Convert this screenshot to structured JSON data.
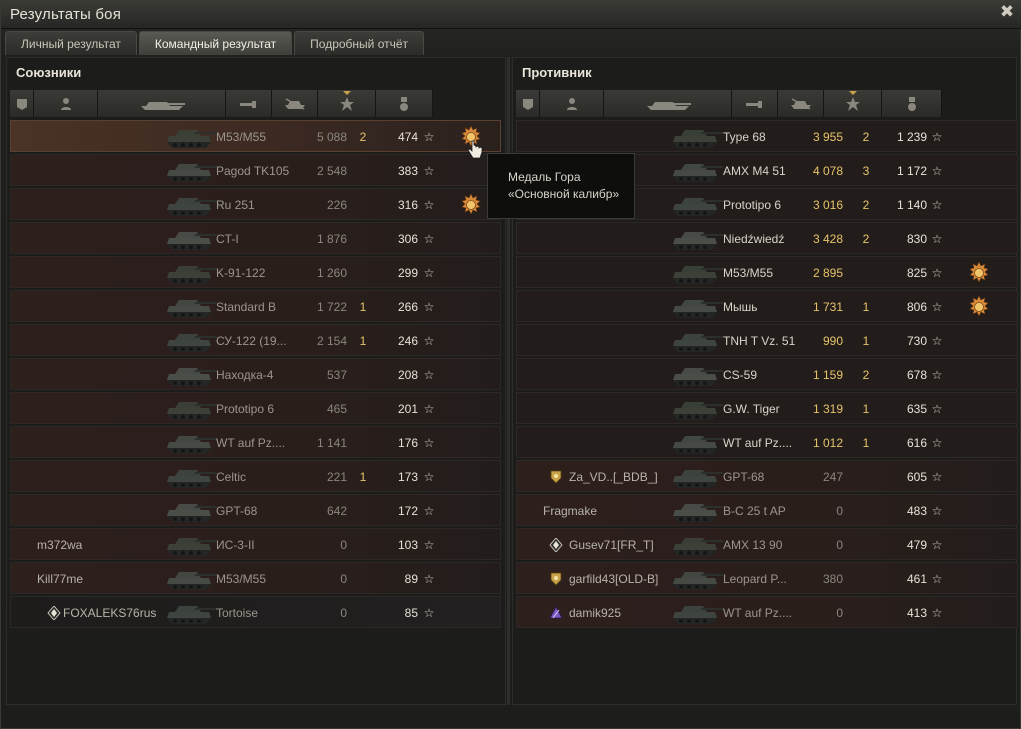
{
  "window": {
    "title": "Результаты боя",
    "close_glyph": "✖"
  },
  "tabs": [
    {
      "label": "Личный результат",
      "active": false
    },
    {
      "label": "Командный результат",
      "active": true
    },
    {
      "label": "Подробный отчёт",
      "active": false
    }
  ],
  "allies": {
    "title": "Союзники",
    "columns": [
      "platoon-icon",
      "player-icon",
      "tank-icon",
      "damage-icon",
      "frags-icon",
      "xp-star-icon",
      "medal-icon"
    ],
    "rows": [
      {
        "player": "",
        "tank": "M53/M55",
        "damage": "5 088",
        "kills": "2",
        "xp": "474",
        "medal": true,
        "style": "self"
      },
      {
        "player": "",
        "tank": "Pagod TK105",
        "damage": "2 548",
        "kills": "",
        "xp": "383",
        "medal": false,
        "style": "tint"
      },
      {
        "player": "",
        "tank": "Ru 251",
        "damage": "226",
        "kills": "",
        "xp": "316",
        "medal": true,
        "style": "tint"
      },
      {
        "player": "",
        "tank": "CT-I",
        "damage": "1 876",
        "kills": "",
        "xp": "306",
        "medal": false,
        "style": "tint"
      },
      {
        "player": "",
        "tank": "K-91-122",
        "damage": "1 260",
        "kills": "",
        "xp": "299",
        "medal": false,
        "style": "tint"
      },
      {
        "player": "",
        "tank": "Standard B",
        "damage": "1 722",
        "kills": "1",
        "xp": "266",
        "medal": false,
        "style": "tint"
      },
      {
        "player": "",
        "tank": "СУ-122 (19...",
        "damage": "2 154",
        "kills": "1",
        "xp": "246",
        "medal": false,
        "style": "tint"
      },
      {
        "player": "",
        "tank": "Находка-4",
        "damage": "537",
        "kills": "",
        "xp": "208",
        "medal": false,
        "style": "tint"
      },
      {
        "player": "",
        "tank": "Prototipo 6",
        "damage": "465",
        "kills": "",
        "xp": "201",
        "medal": false,
        "style": "tint"
      },
      {
        "player": "",
        "tank": "WT auf Pz....",
        "damage": "1 141",
        "kills": "",
        "xp": "176",
        "medal": false,
        "style": "tint"
      },
      {
        "player": "",
        "tank": "Celtic",
        "damage": "221",
        "kills": "1",
        "xp": "173",
        "medal": false,
        "style": "tint"
      },
      {
        "player": "",
        "tank": "GPT-68",
        "damage": "642",
        "kills": "",
        "xp": "172",
        "medal": false,
        "style": "tint"
      },
      {
        "player": "m372wa",
        "tank": "ИС-3-II",
        "damage": "0",
        "kills": "",
        "xp": "103",
        "medal": false,
        "style": "tint"
      },
      {
        "player": "Kill77me",
        "tank": "M53/M55",
        "damage": "0",
        "kills": "",
        "xp": "89",
        "medal": false,
        "style": "tint"
      },
      {
        "player": "FOXALEKS76rus",
        "tank": "Tortoise",
        "damage": "0",
        "kills": "",
        "xp": "85",
        "medal": false,
        "style": "dark",
        "badge": "white"
      }
    ]
  },
  "enemies": {
    "title": "Противник",
    "columns": [
      "platoon-icon",
      "player-icon",
      "tank-icon",
      "damage-icon",
      "frags-icon",
      "xp-star-icon",
      "medal-icon"
    ],
    "rows": [
      {
        "player": "",
        "tank": "Type 68",
        "damage": "3 955",
        "kills": "2",
        "xp": "1 239",
        "medal": false
      },
      {
        "player": "",
        "tank": "AMX M4 51",
        "damage": "4 078",
        "kills": "3",
        "xp": "1 172",
        "medal": false
      },
      {
        "player": "",
        "tank": "Prototipo 6",
        "damage": "3 016",
        "kills": "2",
        "xp": "1 140",
        "medal": false
      },
      {
        "player": "",
        "tank": "Niedźwiedź",
        "damage": "3 428",
        "kills": "2",
        "xp": "830",
        "medal": false
      },
      {
        "player": "",
        "tank": "M53/M55",
        "damage": "2 895",
        "kills": "",
        "xp": "825",
        "medal": true
      },
      {
        "player": "",
        "tank": "Мышь",
        "damage": "1 731",
        "kills": "1",
        "xp": "806",
        "medal": true
      },
      {
        "player": "",
        "tank": "TNH T Vz. 51",
        "damage": "990",
        "kills": "1",
        "xp": "730",
        "medal": false
      },
      {
        "player": "",
        "tank": "CS-59",
        "damage": "1 159",
        "kills": "2",
        "xp": "678",
        "medal": false
      },
      {
        "player": "",
        "tank": "G.W. Tiger",
        "damage": "1 319",
        "kills": "1",
        "xp": "635",
        "medal": false
      },
      {
        "player": "",
        "tank": "WT auf Pz....",
        "damage": "1 012",
        "kills": "1",
        "xp": "616",
        "medal": false
      },
      {
        "player": "Za_VD..[_BDB_]",
        "tank": "GPT-68",
        "damage": "247",
        "kills": "",
        "xp": "605",
        "medal": false,
        "dim": true,
        "badge": "gold"
      },
      {
        "player": "Fragmake",
        "tank": "B-C 25 t AP",
        "damage": "0",
        "kills": "",
        "xp": "483",
        "medal": false,
        "dim": true
      },
      {
        "player": "Gusev71[FR_T]",
        "tank": "AMX 13 90",
        "damage": "0",
        "kills": "",
        "xp": "479",
        "medal": false,
        "dim": true,
        "badge": "white"
      },
      {
        "player": "garfild43[OLD-B]",
        "tank": "Leopard P...",
        "damage": "380",
        "kills": "",
        "xp": "461",
        "medal": false,
        "dim": true,
        "badge": "gold"
      },
      {
        "player": "damik925",
        "tank": "WT auf Pz....",
        "damage": "0",
        "kills": "",
        "xp": "413",
        "medal": false,
        "dim": true,
        "badge": "purple"
      }
    ]
  },
  "tooltip": {
    "line1": "Медаль Гора",
    "line2": "«Основной калибр»"
  },
  "colors": {
    "gold": "#e7c36a",
    "xp": "#e6e2d6",
    "tank_dim": "#9a968c"
  }
}
